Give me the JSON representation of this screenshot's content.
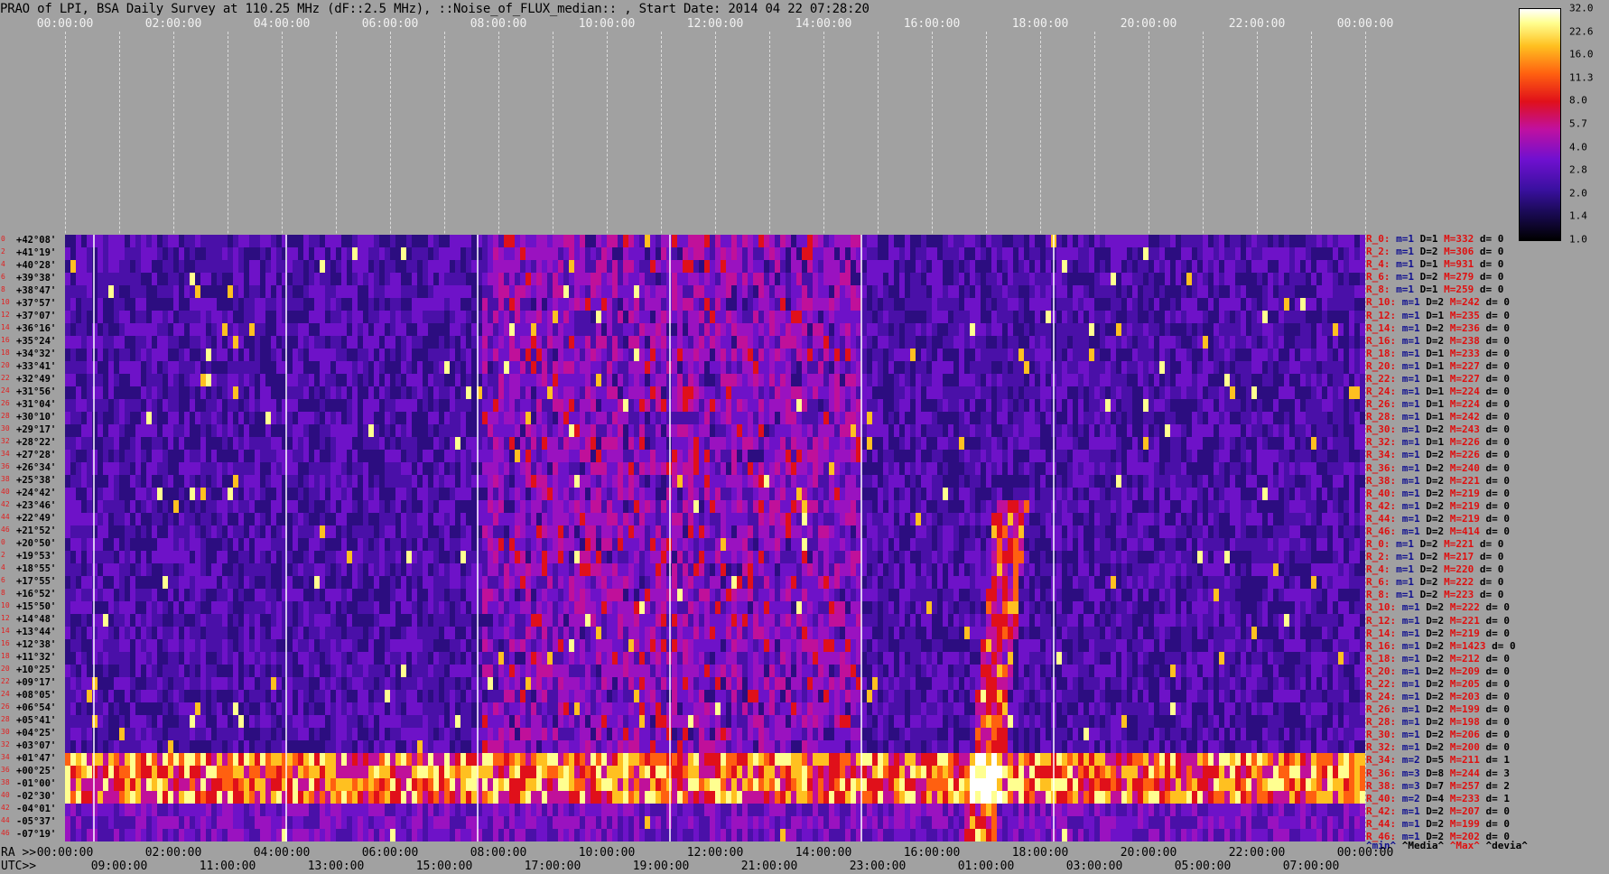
{
  "title": "PRAO of LPI, BSA Daily Survey at 110.25 MHz (dF::2.5 MHz), ::Noise_of_FLUX_median:: , Start Date: 2014 04 22 07:28:20",
  "top_axis": [
    "00:00:00",
    "02:00:00",
    "04:00:00",
    "06:00:00",
    "08:00:00",
    "10:00:00",
    "12:00:00",
    "14:00:00",
    "16:00:00",
    "18:00:00",
    "20:00:00",
    "22:00:00",
    "00:00:00"
  ],
  "ra_axis": {
    "prefix": "RA >>",
    "labels": [
      "00:00:00",
      "02:00:00",
      "04:00:00",
      "06:00:00",
      "08:00:00",
      "10:00:00",
      "12:00:00",
      "14:00:00",
      "16:00:00",
      "18:00:00",
      "20:00:00",
      "22:00:00",
      "00:00:00"
    ]
  },
  "utc_axis": {
    "prefix": "UTC>>",
    "labels": [
      "09:00:00",
      "11:00:00",
      "13:00:00",
      "15:00:00",
      "17:00:00",
      "19:00:00",
      "21:00:00",
      "23:00:00",
      "01:00:00",
      "03:00:00",
      "05:00:00",
      "07:00:00"
    ]
  },
  "declinations": [
    "+42°08'",
    "+41°19'",
    "+40°28'",
    "+39°38'",
    "+38°47'",
    "+37°57'",
    "+37°07'",
    "+36°16'",
    "+35°24'",
    "+34°32'",
    "+33°41'",
    "+32°49'",
    "+31°56'",
    "+31°04'",
    "+30°10'",
    "+29°17'",
    "+28°22'",
    "+27°28'",
    "+26°34'",
    "+25°38'",
    "+24°42'",
    "+23°46'",
    "+22°49'",
    "+21°52'",
    "+20°50'",
    "+19°53'",
    "+18°55'",
    "+17°55'",
    "+16°52'",
    "+15°50'",
    "+14°48'",
    "+13°44'",
    "+12°38'",
    "+11°32'",
    "+10°25'",
    "+09°17'",
    "+08°05'",
    "+06°54'",
    "+05°41'",
    "+04°25'",
    "+03°07'",
    "+01°47'",
    "+00°25'",
    "-01°00'",
    "-02°30'",
    "-04°01'",
    "-05°37'",
    "-07°19'"
  ],
  "row_indices": [
    "0",
    "2",
    "4",
    "6",
    "8",
    "10",
    "12",
    "14",
    "16",
    "18",
    "20",
    "22",
    "24",
    "26",
    "28",
    "30",
    "32",
    "34",
    "36",
    "38",
    "40",
    "42",
    "44",
    "46",
    "0",
    "2",
    "4",
    "6",
    "8",
    "10",
    "12",
    "14",
    "16",
    "18",
    "20",
    "22",
    "24",
    "26",
    "28",
    "30",
    "32",
    "34",
    "36",
    "38",
    "40",
    "42",
    "44",
    "46"
  ],
  "stats": [
    {
      "r": "R_0:",
      "m": "m=1",
      "d": "D=1",
      "mx": "M=332",
      "dv": "d= 0"
    },
    {
      "r": "R_2:",
      "m": "m=1",
      "d": "D=2",
      "mx": "M=306",
      "dv": "d= 0"
    },
    {
      "r": "R_4:",
      "m": "m=1",
      "d": "D=1",
      "mx": "M=931",
      "dv": "d= 0"
    },
    {
      "r": "R_6:",
      "m": "m=1",
      "d": "D=2",
      "mx": "M=279",
      "dv": "d= 0"
    },
    {
      "r": "R_8:",
      "m": "m=1",
      "d": "D=1",
      "mx": "M=259",
      "dv": "d= 0"
    },
    {
      "r": "R_10:",
      "m": "m=1",
      "d": "D=2",
      "mx": "M=242",
      "dv": "d= 0"
    },
    {
      "r": "R_12:",
      "m": "m=1",
      "d": "D=1",
      "mx": "M=235",
      "dv": "d= 0"
    },
    {
      "r": "R_14:",
      "m": "m=1",
      "d": "D=2",
      "mx": "M=236",
      "dv": "d= 0"
    },
    {
      "r": "R_16:",
      "m": "m=1",
      "d": "D=2",
      "mx": "M=238",
      "dv": "d= 0"
    },
    {
      "r": "R_18:",
      "m": "m=1",
      "d": "D=1",
      "mx": "M=233",
      "dv": "d= 0"
    },
    {
      "r": "R_20:",
      "m": "m=1",
      "d": "D=1",
      "mx": "M=227",
      "dv": "d= 0"
    },
    {
      "r": "R_22:",
      "m": "m=1",
      "d": "D=1",
      "mx": "M=227",
      "dv": "d= 0"
    },
    {
      "r": "R_24:",
      "m": "m=1",
      "d": "D=1",
      "mx": "M=224",
      "dv": "d= 0"
    },
    {
      "r": "R_26:",
      "m": "m=1",
      "d": "D=1",
      "mx": "M=224",
      "dv": "d= 0"
    },
    {
      "r": "R_28:",
      "m": "m=1",
      "d": "D=1",
      "mx": "M=242",
      "dv": "d= 0"
    },
    {
      "r": "R_30:",
      "m": "m=1",
      "d": "D=2",
      "mx": "M=243",
      "dv": "d= 0"
    },
    {
      "r": "R_32:",
      "m": "m=1",
      "d": "D=1",
      "mx": "M=226",
      "dv": "d= 0"
    },
    {
      "r": "R_34:",
      "m": "m=1",
      "d": "D=2",
      "mx": "M=226",
      "dv": "d= 0"
    },
    {
      "r": "R_36:",
      "m": "m=1",
      "d": "D=2",
      "mx": "M=240",
      "dv": "d= 0"
    },
    {
      "r": "R_38:",
      "m": "m=1",
      "d": "D=2",
      "mx": "M=221",
      "dv": "d= 0"
    },
    {
      "r": "R_40:",
      "m": "m=1",
      "d": "D=2",
      "mx": "M=219",
      "dv": "d= 0"
    },
    {
      "r": "R_42:",
      "m": "m=1",
      "d": "D=2",
      "mx": "M=219",
      "dv": "d= 0"
    },
    {
      "r": "R_44:",
      "m": "m=1",
      "d": "D=2",
      "mx": "M=219",
      "dv": "d= 0"
    },
    {
      "r": "R_46:",
      "m": "m=1",
      "d": "D=2",
      "mx": "M=414",
      "dv": "d= 0"
    },
    {
      "r": "R_0:",
      "m": "m=1",
      "d": "D=2",
      "mx": "M=221",
      "dv": "d= 0"
    },
    {
      "r": "R_2:",
      "m": "m=1",
      "d": "D=2",
      "mx": "M=217",
      "dv": "d= 0"
    },
    {
      "r": "R_4:",
      "m": "m=1",
      "d": "D=2",
      "mx": "M=220",
      "dv": "d= 0"
    },
    {
      "r": "R_6:",
      "m": "m=1",
      "d": "D=2",
      "mx": "M=222",
      "dv": "d= 0"
    },
    {
      "r": "R_8:",
      "m": "m=1",
      "d": "D=2",
      "mx": "M=223",
      "dv": "d= 0"
    },
    {
      "r": "R_10:",
      "m": "m=1",
      "d": "D=2",
      "mx": "M=222",
      "dv": "d= 0"
    },
    {
      "r": "R_12:",
      "m": "m=1",
      "d": "D=2",
      "mx": "M=221",
      "dv": "d= 0"
    },
    {
      "r": "R_14:",
      "m": "m=1",
      "d": "D=2",
      "mx": "M=219",
      "dv": "d= 0"
    },
    {
      "r": "R_16:",
      "m": "m=1",
      "d": "D=2",
      "mx": "M=1423",
      "dv": "d= 0"
    },
    {
      "r": "R_18:",
      "m": "m=1",
      "d": "D=2",
      "mx": "M=212",
      "dv": "d= 0"
    },
    {
      "r": "R_20:",
      "m": "m=1",
      "d": "D=2",
      "mx": "M=209",
      "dv": "d= 0"
    },
    {
      "r": "R_22:",
      "m": "m=1",
      "d": "D=2",
      "mx": "M=205",
      "dv": "d= 0"
    },
    {
      "r": "R_24:",
      "m": "m=1",
      "d": "D=2",
      "mx": "M=203",
      "dv": "d= 0"
    },
    {
      "r": "R_26:",
      "m": "m=1",
      "d": "D=2",
      "mx": "M=199",
      "dv": "d= 0"
    },
    {
      "r": "R_28:",
      "m": "m=1",
      "d": "D=2",
      "mx": "M=198",
      "dv": "d= 0"
    },
    {
      "r": "R_30:",
      "m": "m=1",
      "d": "D=2",
      "mx": "M=206",
      "dv": "d= 0"
    },
    {
      "r": "R_32:",
      "m": "m=1",
      "d": "D=2",
      "mx": "M=200",
      "dv": "d= 0"
    },
    {
      "r": "R_34:",
      "m": "m=2",
      "d": "D=5",
      "mx": "M=211",
      "dv": "d= 1"
    },
    {
      "r": "R_36:",
      "m": "m=3",
      "d": "D=8",
      "mx": "M=244",
      "dv": "d= 3"
    },
    {
      "r": "R_38:",
      "m": "m=3",
      "d": "D=7",
      "mx": "M=257",
      "dv": "d= 2"
    },
    {
      "r": "R_40:",
      "m": "m=2",
      "d": "D=4",
      "mx": "M=233",
      "dv": "d= 1"
    },
    {
      "r": "R_42:",
      "m": "m=1",
      "d": "D=2",
      "mx": "M=207",
      "dv": "d= 0"
    },
    {
      "r": "R_44:",
      "m": "m=1",
      "d": "D=2",
      "mx": "M=199",
      "dv": "d= 0"
    },
    {
      "r": "R_46:",
      "m": "m=1",
      "d": "D=2",
      "mx": "M=202",
      "dv": "d= 0"
    }
  ],
  "stats_legend": {
    "min": "^min^",
    "media": "^Media^",
    "max": "^Max^",
    "devia": "^devia^"
  },
  "colorbar_labels": [
    "32.0",
    "22.6",
    "16.0",
    "11.3",
    "8.0",
    "5.7",
    "4.0",
    "2.8",
    "2.0",
    "1.4",
    "1.0"
  ],
  "colors": {
    "background": "#a1a1a1",
    "low": "#1a0a55",
    "mid": "#7010d0",
    "high": "#e0101a",
    "peak": "#ffff90"
  }
}
